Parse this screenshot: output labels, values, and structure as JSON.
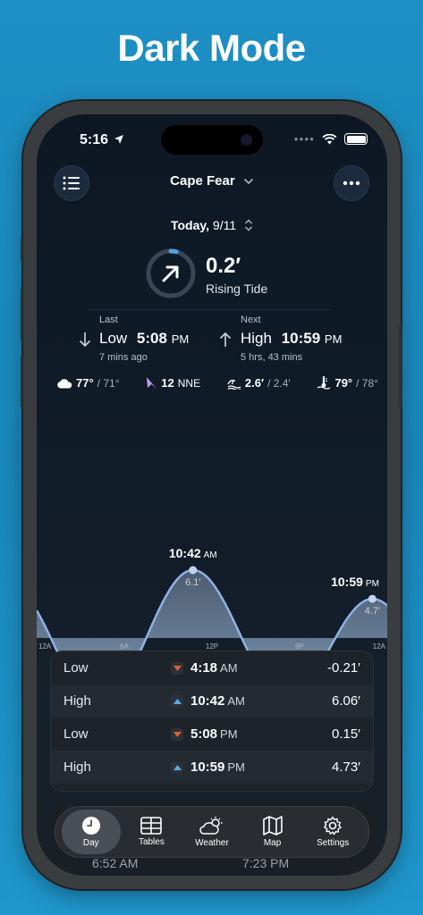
{
  "marketing_title": "Dark Mode",
  "status_bar": {
    "time": "5:16"
  },
  "header": {
    "location": "Cape Fear",
    "date_label": "Today,",
    "date_value": "9/11"
  },
  "current": {
    "height": "0.2′",
    "state": "Rising Tide",
    "progress": 0.04
  },
  "last": {
    "label": "Last",
    "type": "Low",
    "time": "5:08",
    "ampm": "PM",
    "ago": "7 mins ago"
  },
  "next": {
    "label": "Next",
    "type": "High",
    "time": "10:59",
    "ampm": "PM",
    "in": "5 hrs, 43 mins"
  },
  "weather": {
    "temp": "77°",
    "temp_low": "/ 71°",
    "wind_speed": "12",
    "wind_dir": "NNE",
    "wave": "2.6′",
    "wave_low": "/ 2.4′",
    "water_temp": "79°",
    "water_temp_low": "/ 78°"
  },
  "chart_data": {
    "type": "area",
    "x_ticks": [
      "12A",
      "6A",
      "12P",
      "6P",
      "12A"
    ],
    "points": [
      {
        "time": "4:18",
        "ampm": "AM",
        "label": "-0.2′",
        "hour": 4.3,
        "value": -0.21
      },
      {
        "time": "10:42",
        "ampm": "AM",
        "label": "6.1′",
        "hour": 10.7,
        "value": 6.06
      },
      {
        "time": "5:08",
        "ampm": "PM",
        "label": "0.2′",
        "hour": 17.13,
        "value": 0.15,
        "current": true
      },
      {
        "time": "10:59",
        "ampm": "PM",
        "label": "4.7′",
        "hour": 22.98,
        "value": 4.73
      }
    ]
  },
  "tide_table": [
    {
      "type": "Low",
      "dir": "down",
      "time": "4:18",
      "ampm": "AM",
      "height": "-0.21′"
    },
    {
      "type": "High",
      "dir": "up",
      "time": "10:42",
      "ampm": "AM",
      "height": "6.06′"
    },
    {
      "type": "Low",
      "dir": "down",
      "time": "5:08",
      "ampm": "PM",
      "height": "0.15′"
    },
    {
      "type": "High",
      "dir": "up",
      "time": "10:59",
      "ampm": "PM",
      "height": "4.73′"
    }
  ],
  "behind_tabbar": {
    "left": "6:52 AM",
    "right": "7:23 PM"
  },
  "tabs": [
    {
      "label": "Day",
      "icon": "clock-icon"
    },
    {
      "label": "Tables",
      "icon": "table-icon"
    },
    {
      "label": "Weather",
      "icon": "partly-cloudy-icon"
    },
    {
      "label": "Map",
      "icon": "map-icon"
    },
    {
      "label": "Settings",
      "icon": "gear-icon"
    }
  ],
  "colors": {
    "rising": "#5ba9e8",
    "falling": "#e0603a",
    "current_dot": "#e8382a",
    "curve": "#8fb2e6"
  }
}
